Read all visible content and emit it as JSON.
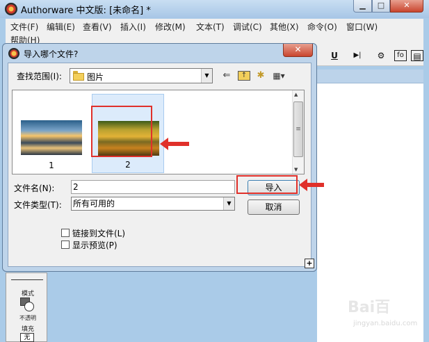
{
  "app": {
    "title": "Authorware 中文版: [未命名] *",
    "controls": {
      "minimize": "▁",
      "maximize": "□",
      "close": "✕"
    }
  },
  "menubar": {
    "items": [
      "文件(F)",
      "编辑(E)",
      "查看(V)",
      "插入(I)",
      "修改(M)",
      "文本(T)",
      "调试(C)",
      "其他(X)",
      "命令(O)",
      "窗口(W)",
      "帮助(H)"
    ]
  },
  "toolbar": {
    "icons": [
      "underline-icon",
      "step-icon",
      "trace-icon",
      "function-icon",
      "window-icon"
    ],
    "glyphs": [
      "U",
      "▶|",
      "⚙",
      "fo",
      "▤"
    ]
  },
  "dialog": {
    "title": "导入哪个文件?",
    "close": "✕",
    "look_in_label": "查找范围(I):",
    "look_in_value": "图片",
    "files": [
      {
        "label": "1",
        "thumbnail": "mountain-landscape-thumbnail",
        "selected": false
      },
      {
        "label": "2",
        "thumbnail": "autumn-forest-thumbnail",
        "selected": true
      }
    ],
    "file_name_label": "文件名(N):",
    "file_name_value": "2",
    "file_type_label": "文件类型(T):",
    "file_type_value": "所有可用的",
    "import_button": "导入",
    "cancel_button": "取消",
    "link_to_file": "链接到文件(L)",
    "show_preview": "显示预览(P)",
    "plus": "+"
  },
  "side_panel": {
    "mode_label": "模式",
    "mode_value": "不透明",
    "fill_label": "填充",
    "fill_value": "无"
  },
  "watermark": {
    "text": "Bai百",
    "sub": "jingyan.baidu.com"
  },
  "colors": {
    "annotation": "#e0302a",
    "dialog_frame": "#bed4ea",
    "selection": "#dcebfb"
  }
}
